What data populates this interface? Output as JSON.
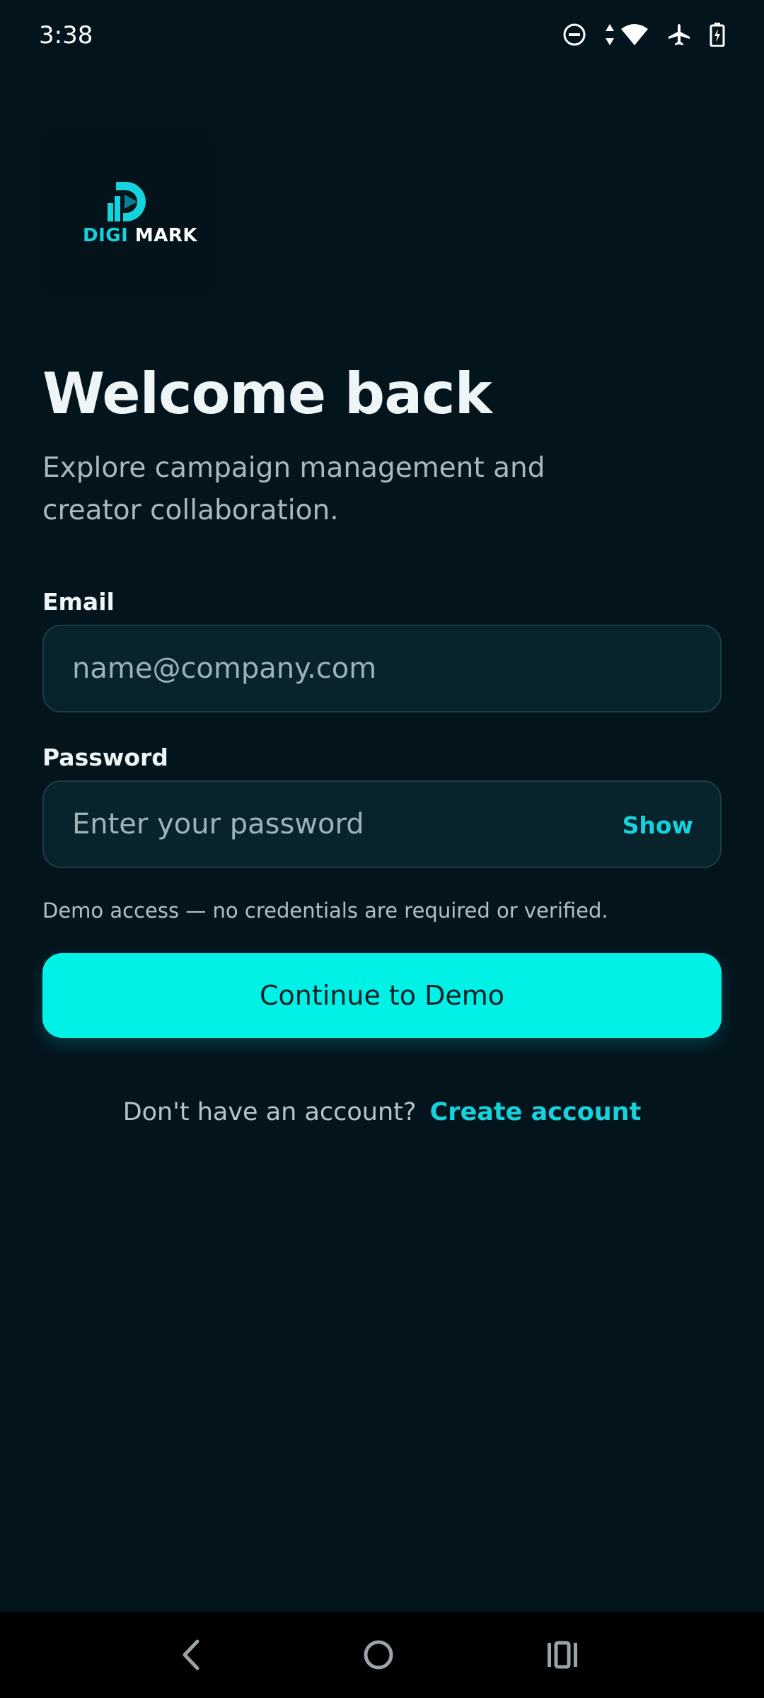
{
  "status_bar": {
    "time": "3:38",
    "icons": [
      "do-not-disturb-icon",
      "data-arrows-icon",
      "wifi-icon",
      "airplane-mode-icon",
      "battery-charging-icon"
    ]
  },
  "logo": {
    "brand_part1": "DIGI",
    "brand_part2": "MARK",
    "icon": "digimark-logo-icon"
  },
  "header": {
    "title": "Welcome back",
    "subtitle": "Explore campaign management and creator collaboration."
  },
  "form": {
    "email": {
      "label": "Email",
      "value": "",
      "placeholder": "name@company.com"
    },
    "password": {
      "label": "Password",
      "value": "",
      "placeholder": "Enter your password",
      "toggle_label": "Show"
    },
    "demo_note": "Demo access — no credentials are required or verified.",
    "submit_label": "Continue to Demo"
  },
  "signup": {
    "prompt": "Don't have an account?",
    "link_label": "Create account"
  },
  "nav_bar": {
    "icons": [
      "back-icon",
      "home-icon",
      "recents-icon"
    ]
  },
  "colors": {
    "background": "#04141d",
    "accent": "#00f1e6",
    "link": "#14d3dc",
    "field_bg": "#08232c",
    "field_border": "#1d3c45"
  }
}
